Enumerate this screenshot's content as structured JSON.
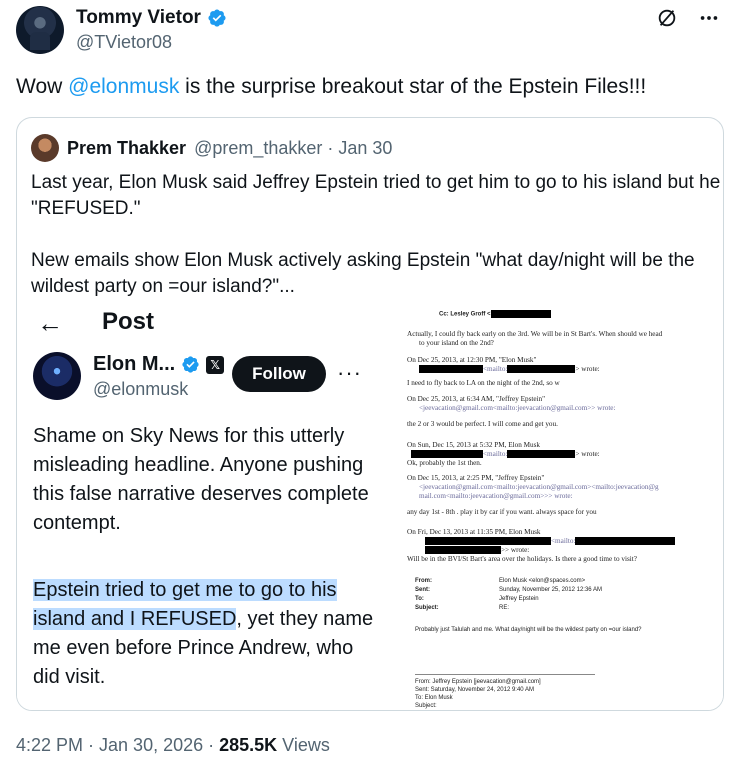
{
  "author": {
    "display_name": "Tommy Vietor",
    "handle": "@TVietor08"
  },
  "tweet": {
    "prefix": "Wow ",
    "mention": "@elonmusk",
    "suffix": " is the surprise breakout star of the Epstein Files!!!"
  },
  "quote": {
    "display_name": "Prem Thakker",
    "meta": "@prem_thakker · Jan 30",
    "text_line1": "Last year, Elon Musk said Jeffrey Epstein tried to get him to go to his island but he \"REFUSED.\"",
    "text_line2": "New emails show Elon Musk actively asking Epstein \"what day/night will be the wildest party on =our island?\"..."
  },
  "screenshot_post": {
    "title": "Post",
    "name": "Elon M...",
    "handle": "@elonmusk",
    "follow_label": "Follow",
    "body1": "Shame on Sky News for this utterly misleading headline. Anyone pushing this false narrative deserves complete contempt.",
    "highlight": "Epstein tried to get me to go to his island and I REFUSED",
    "body2_rest": ", yet they name me even before Prince Andrew, who did visit."
  },
  "document": {
    "cc": "Cc: Lesley Groff <",
    "l1": "Actually, I could fly back early on the 3rd. We will be in St Bart's. When should we head",
    "l2": "to your island on the 2nd?",
    "l3": "On Dec 25, 2013, at 12:30 PM, \"Elon Musk\"",
    "l4": "<mailto:",
    "l4b": "> wrote:",
    "l5": "I need to fly back to LA on the night of the 2nd, so w",
    "l6": "On Dec 25, 2013, at 6:34 AM, \"Jeffrey Epstein\"",
    "l7": "<jeevacation@gmail.com<mailto:jeevacation@gmail.com>> wrote:",
    "l8": "the 2 or 3 would be perfect.   I will come and get you.",
    "l9": "On Sun, Dec 15, 2013 at 5:32 PM, Elon Musk",
    "l10": "<mailto:",
    "l10b": "> wrote:",
    "l11": "Ok, probably the 1st then.",
    "l12": "On Dec 15, 2013, at 2:25 PM, \"Jeffrey Epstein\"",
    "l13": "<jeevacation@gmail.com<mailto:jeevacation@gmail.com><mailto:jeevacation@g",
    "l14": "mail.com<mailto:jeevacation@gmail.com>>> wrote:",
    "l15": "any day 1st - 8th . play it by car if you want. always space for you",
    "l16": "On Fri, Dec 13, 2013 at 11:35 PM, Elon Musk",
    "l17": "<mailto:",
    "l18": ">> wrote:",
    "l19": "Will be in the BVI/St Bart's area over the holidays. Is there a good time to visit?",
    "hdr_from": "From:",
    "hdr_sent": "Sent:",
    "hdr_to": "To:",
    "hdr_subject": "Subject:",
    "val_from": "Elon Musk <elon@spaces.com>",
    "val_sent": "Sunday, November 25, 2012 12:36 AM",
    "val_to": "Jeffrey Epstein",
    "val_subject": "RE:",
    "body": "Probably just Talulah and me.  What day/night will be the wildest party on =our island?",
    "f1": "From: Jeffrey Epstein [jeevacation@gmail.com]",
    "f2": "Sent: Saturday, November 24, 2012 9:40 AM",
    "f3": "To: Elon Musk",
    "f4": "Subject:"
  },
  "footer": {
    "time": "4:22 PM · Jan 30, 2026 · ",
    "views_count": "285.5K",
    "views_label": " Views"
  },
  "colors": {
    "accent": "#1d9bf0",
    "highlight": "#bcdcff",
    "secondary_text": "#536471"
  },
  "icons": [
    "verified-badge-icon",
    "grok-icon",
    "more-icon",
    "back-arrow-icon",
    "x-affiliate-icon"
  ]
}
